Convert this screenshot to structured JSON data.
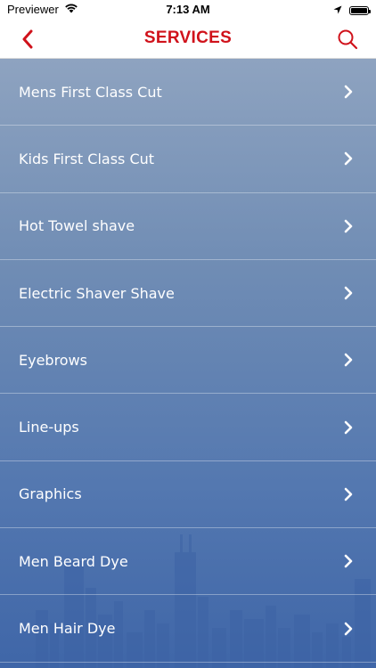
{
  "status_bar": {
    "carrier": "Previewer",
    "time": "7:13 AM"
  },
  "nav": {
    "title": "SERVICES",
    "accent_color": "#d0121b"
  },
  "services": [
    {
      "label": "Mens First Class Cut"
    },
    {
      "label": "Kids First Class Cut"
    },
    {
      "label": "Hot Towel shave"
    },
    {
      "label": "Electric Shaver Shave"
    },
    {
      "label": "Eyebrows"
    },
    {
      "label": "Line-ups"
    },
    {
      "label": "Graphics"
    },
    {
      "label": "Men Beard Dye"
    },
    {
      "label": "Men Hair Dye"
    }
  ],
  "icons": {
    "back": "chevron-left-icon",
    "search": "search-icon",
    "row_disclosure": "chevron-right-icon"
  }
}
